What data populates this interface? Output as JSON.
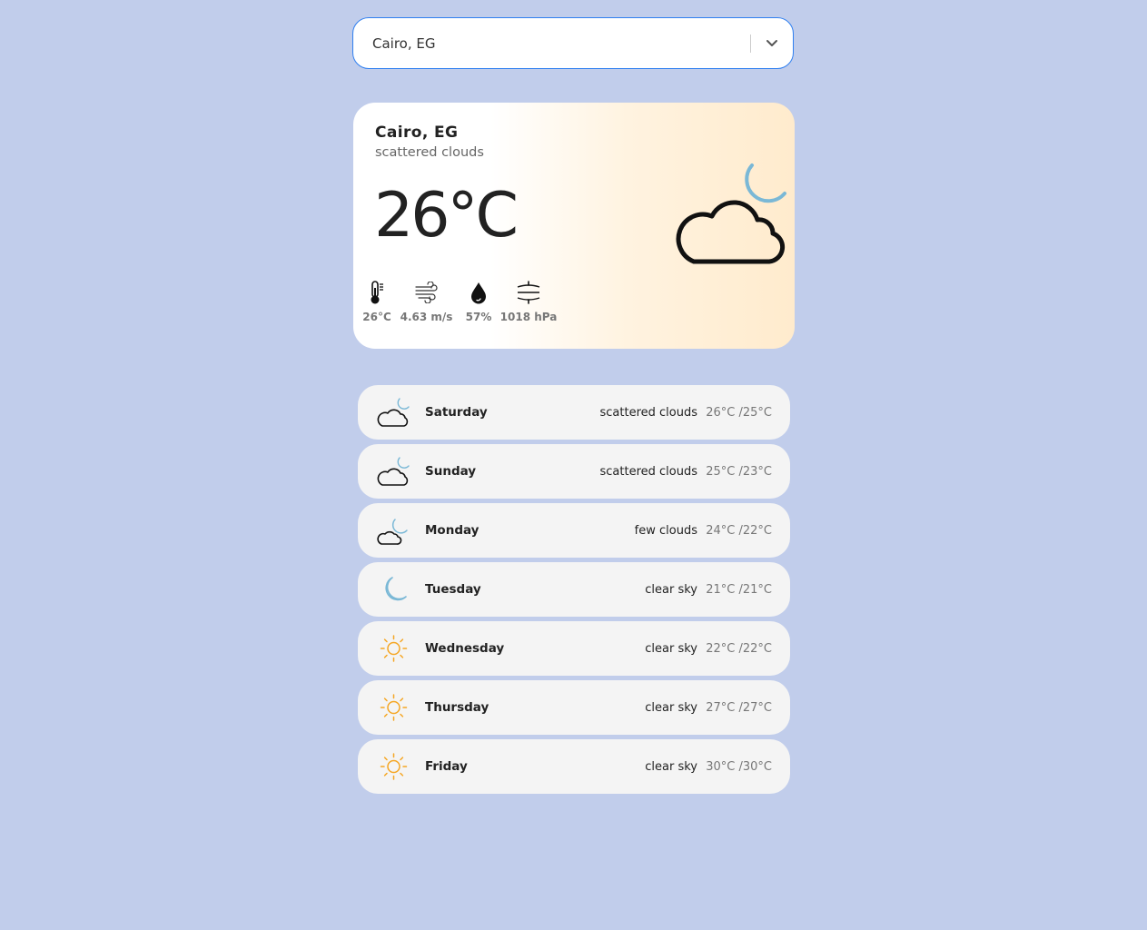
{
  "search": {
    "value": "Cairo, EG"
  },
  "current": {
    "city": "Cairo, EG",
    "description": "scattered clouds",
    "temperature": "26°C",
    "icon": "cloud-moon-icon",
    "stats": [
      {
        "icon": "thermometer-icon",
        "value": "26°C"
      },
      {
        "icon": "wind-icon",
        "value": "4.63 m/s"
      },
      {
        "icon": "humidity-drop-icon",
        "value": "57%"
      },
      {
        "icon": "pressure-icon",
        "value": "1018 hPa"
      }
    ]
  },
  "colors": {
    "background": "#c1cdeb",
    "accent_border": "#2f7ff0",
    "moon": "#7ab8d6",
    "sun": "#f5a623",
    "row_background": "#f4f4f4"
  },
  "forecast": [
    {
      "day": "Saturday",
      "description": "scattered clouds",
      "temps": "26°C /25°C",
      "icon": "cloud-moon-icon"
    },
    {
      "day": "Sunday",
      "description": "scattered clouds",
      "temps": "25°C /23°C",
      "icon": "cloud-moon-icon"
    },
    {
      "day": "Monday",
      "description": "few clouds",
      "temps": "24°C /22°C",
      "icon": "few-clouds-moon-icon"
    },
    {
      "day": "Tuesday",
      "description": "clear sky",
      "temps": "21°C /21°C",
      "icon": "moon-icon"
    },
    {
      "day": "Wednesday",
      "description": "clear sky",
      "temps": "22°C /22°C",
      "icon": "sun-icon"
    },
    {
      "day": "Thursday",
      "description": "clear sky",
      "temps": "27°C /27°C",
      "icon": "sun-icon"
    },
    {
      "day": "Friday",
      "description": "clear sky",
      "temps": "30°C /30°C",
      "icon": "sun-icon"
    }
  ]
}
